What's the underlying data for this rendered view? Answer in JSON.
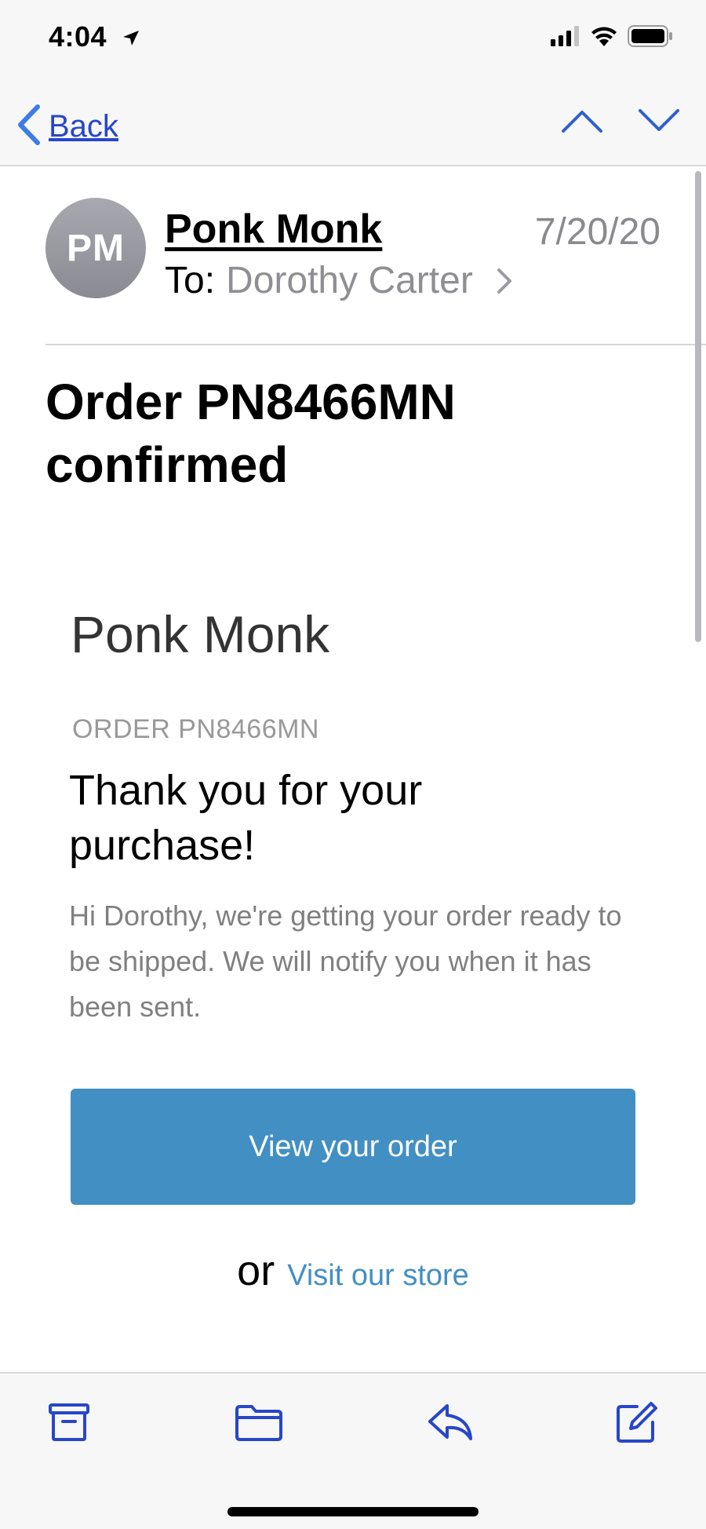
{
  "status_bar": {
    "time": "4:04",
    "icons": [
      "location-arrow-icon",
      "cellular-signal-icon",
      "wifi-icon",
      "battery-icon"
    ]
  },
  "nav": {
    "back_label": "Back",
    "back_icon": "chevron-left-icon",
    "prev_icon": "chevron-up-icon",
    "next_icon": "chevron-down-icon",
    "accent_color": "#2746c9"
  },
  "header": {
    "avatar_initials": "PM",
    "sender": "Ponk Monk",
    "date": "7/20/20",
    "to_label": "To:",
    "recipient": "Dorothy Carter"
  },
  "subject": "Order PN8466MN confirmed",
  "email_body": {
    "brand": "Ponk Monk",
    "order_label": "ORDER PN8466MN",
    "heading": "Thank you for your purchase!",
    "message": "Hi Dorothy, we're getting your order ready to be shipped. We will notify you when it has been sent.",
    "primary_button": "View your order",
    "or_text": "or",
    "secondary_link": "Visit our store",
    "button_color": "#428fc3"
  },
  "toolbar": {
    "icons": [
      "archive-icon",
      "folder-icon",
      "reply-icon",
      "compose-icon"
    ]
  }
}
